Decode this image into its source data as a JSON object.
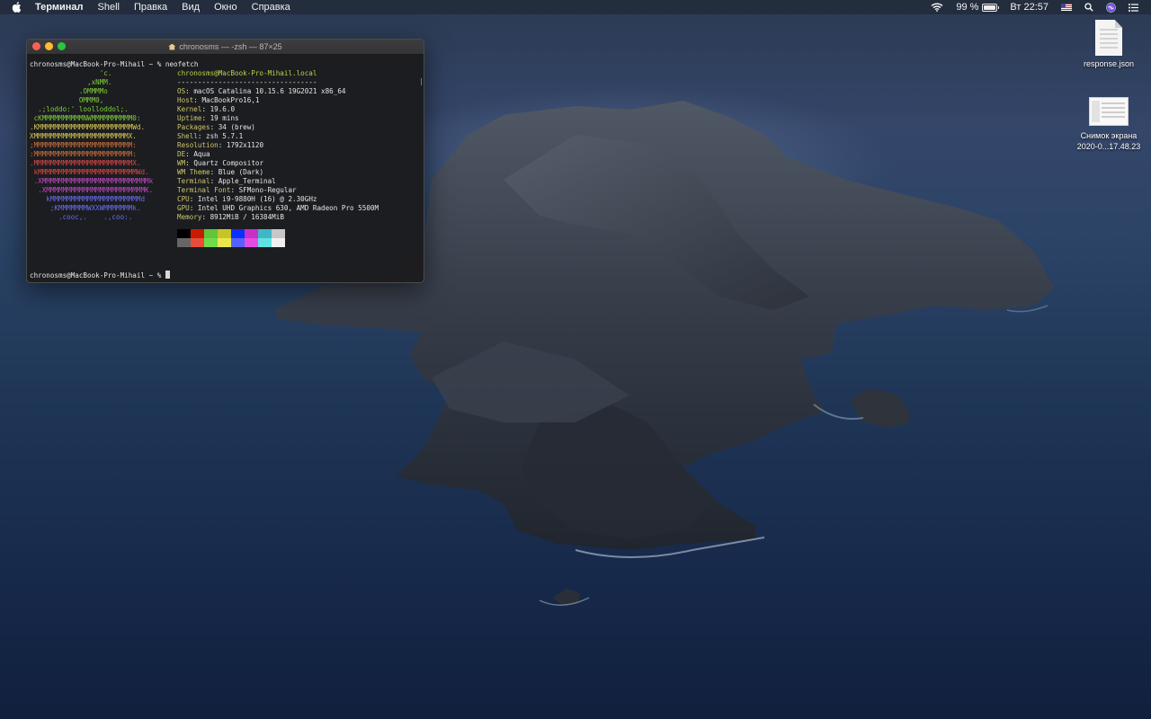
{
  "menubar": {
    "items": [
      "Терминал",
      "Shell",
      "Правка",
      "Вид",
      "Окно",
      "Справка"
    ],
    "battery_percent": "99 %",
    "battery_level": 0.99,
    "clock": "Вт 22:57"
  },
  "terminal": {
    "title": "chronosms — -zsh — 87×25",
    "prompt_command": "chronosms@MacBook-Pro-Mihail ~ % neofetch",
    "prompt_final": "chronosms@MacBook-Pro-Mihail ~ % ",
    "logo_lines": [
      {
        "text": "                 'c.",
        "color": "#7fcf3a"
      },
      {
        "text": "              ,xNMM.",
        "color": "#7fcf3a"
      },
      {
        "text": "            .OMMMMo",
        "color": "#7fcf3a"
      },
      {
        "text": "            OMMM0,",
        "color": "#7fcf3a"
      },
      {
        "text": "  .;loddo:' loolloddol;.",
        "color": "#7fcf3a"
      },
      {
        "text": " cKMMMMMMMMMMNWMMMMMMMMMM0:",
        "color": "#7fcf3a"
      },
      {
        "text": ".KMMMMMMMMMMMMMMMMMMMMMMMWd.",
        "color": "#d9c955"
      },
      {
        "text": "XMMMMMMMMMMMMMMMMMMMMMMMX.",
        "color": "#d9c955"
      },
      {
        "text": ";MMMMMMMMMMMMMMMMMMMMMMMM:",
        "color": "#d0703a"
      },
      {
        "text": ":MMMMMMMMMMMMMMMMMMMMMMMM:",
        "color": "#d0703a"
      },
      {
        "text": ".MMMMMMMMMMMMMMMMMMMMMMMMX.",
        "color": "#d84a4a"
      },
      {
        "text": " kMMMMMMMMMMMMMMMMMMMMMMMMWd.",
        "color": "#d84a4a"
      },
      {
        "text": " .XMMMMMMMMMMMMMMMMMMMMMMMMMMk",
        "color": "#c24ac7"
      },
      {
        "text": "  .XMMMMMMMMMMMMMMMMMMMMMMMMK.",
        "color": "#c24ac7"
      },
      {
        "text": "    kMMMMMMMMMMMMMMMMMMMMMMd",
        "color": "#6a6ef0"
      },
      {
        "text": "     ;KMMMMMMMWXXWMMMMMMMk.",
        "color": "#6a6ef0"
      },
      {
        "text": "       .cooc,.    .,coo:.",
        "color": "#6a6ef0"
      }
    ],
    "user_host": "chronosms@MacBook-Pro-Mihail.local",
    "separator": "----------------------------------",
    "info": [
      {
        "key": "OS",
        "value": "macOS Catalina 10.15.6 19G2021 x86_64"
      },
      {
        "key": "Host",
        "value": "MacBookPro16,1"
      },
      {
        "key": "Kernel",
        "value": "19.6.0"
      },
      {
        "key": "Uptime",
        "value": "19 mins"
      },
      {
        "key": "Packages",
        "value": "34 (brew)"
      },
      {
        "key": "Shell",
        "value": "zsh 5.7.1"
      },
      {
        "key": "Resolution",
        "value": "1792x1120"
      },
      {
        "key": "DE",
        "value": "Aqua"
      },
      {
        "key": "WM",
        "value": "Quartz Compositor"
      },
      {
        "key": "WM Theme",
        "value": "Blue (Dark)"
      },
      {
        "key": "Terminal",
        "value": "Apple_Terminal"
      },
      {
        "key": "Terminal Font",
        "value": "SFMono-Regular"
      },
      {
        "key": "CPU",
        "value": "Intel i9-9880H (16) @ 2.30GHz"
      },
      {
        "key": "GPU",
        "value": "Intel UHD Graphics 630, AMD Radeon Pro 5500M"
      },
      {
        "key": "Memory",
        "value": "8912MiB / 16384MiB"
      }
    ],
    "palette": [
      [
        "#000000",
        "#666666"
      ],
      [
        "#c91b00",
        "#e74c3c"
      ],
      [
        "#5fc53a",
        "#6fdc4a"
      ],
      [
        "#c7c429",
        "#e8e84e"
      ],
      [
        "#0a2fff",
        "#5560ff"
      ],
      [
        "#c930c7",
        "#e34be3"
      ],
      [
        "#3fb6c6",
        "#5fe2e2"
      ],
      [
        "#c7c7c7",
        "#f0f0f0"
      ]
    ]
  },
  "desktop": {
    "icon1_label": "response.json",
    "icon2_label_line1": "Снимок экрана",
    "icon2_label_line2": "2020-0...17.48.23"
  }
}
